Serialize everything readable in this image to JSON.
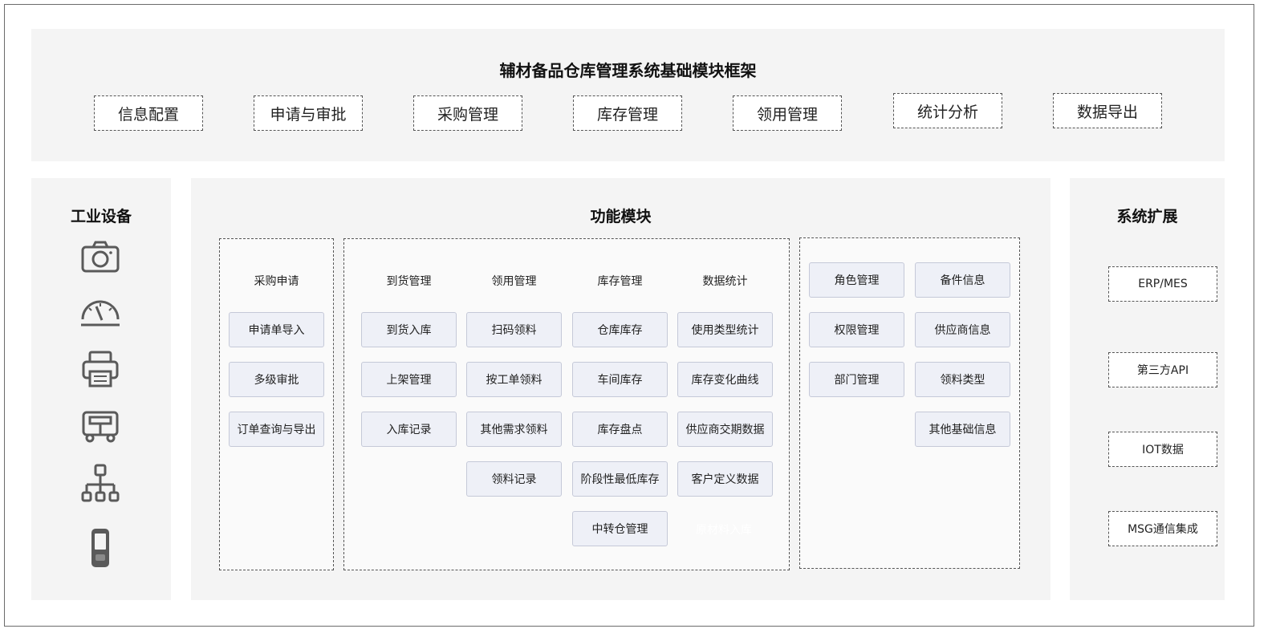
{
  "header": {
    "title": "辅材备品仓库管理系统基础模块框架",
    "modules": [
      "信息配置",
      "申请与审批",
      "采购管理",
      "库存管理",
      "领用管理",
      "统计分析",
      "数据导出"
    ]
  },
  "left_panel": {
    "title": "工业设备",
    "icons": [
      "camera-icon",
      "gauge-icon",
      "printer-icon",
      "vehicle-icon",
      "org-chart-icon",
      "handheld-scanner-icon"
    ]
  },
  "center_panel": {
    "title": "功能模块",
    "purchase_group": {
      "heading": "采购申请",
      "items": [
        "申请单导入",
        "多级审批",
        "订单查询与导出"
      ]
    },
    "main_group": {
      "columns": [
        {
          "heading": "到货管理",
          "items": [
            "到货入库",
            "上架管理",
            "入库记录"
          ]
        },
        {
          "heading": "领用管理",
          "items": [
            "扫码领料",
            "按工单领料",
            "其他需求领料",
            "领料记录"
          ]
        },
        {
          "heading": "库存管理",
          "items": [
            "仓库库存",
            "车间库存",
            "库存盘点",
            "阶段性最低库存",
            "中转仓管理"
          ]
        },
        {
          "heading": "数据统计",
          "items": [
            "使用类型统计",
            "库存变化曲线",
            "供应商交期数据",
            "客户定义数据",
            "原材料入库"
          ]
        }
      ]
    },
    "base_group": {
      "left_items": [
        "角色管理",
        "权限管理",
        "部门管理"
      ],
      "right_items": [
        "备件信息",
        "供应商信息",
        "领料类型",
        "其他基础信息"
      ]
    }
  },
  "right_panel": {
    "title": "系统扩展",
    "items": [
      "ERP/MES",
      "第三方API",
      "IOT数据",
      "MSG通信集成"
    ]
  },
  "colors": {
    "panel_bg": "#f4f4f4",
    "button_bg": "#eef0f7",
    "button_border": "#c5c9d8",
    "icon": "#5a5a5a"
  }
}
